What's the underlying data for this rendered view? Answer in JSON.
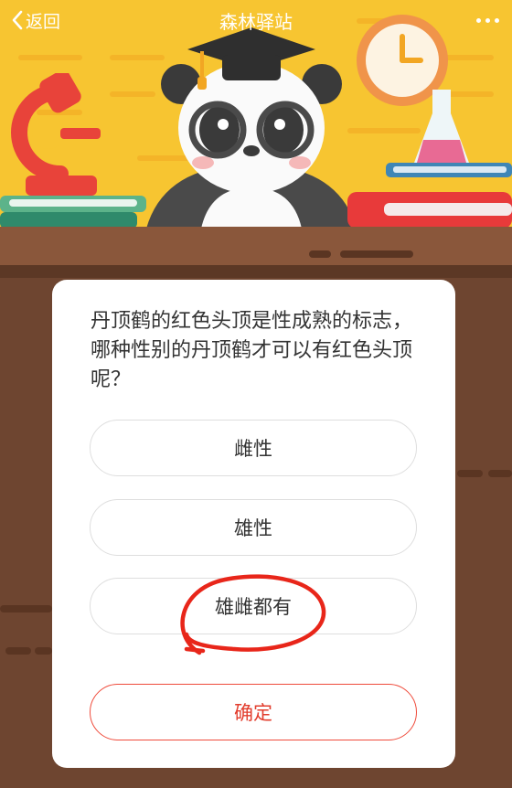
{
  "nav": {
    "back_label": "返回",
    "title": "森林驿站"
  },
  "quiz": {
    "question": "丹顶鹤的红色头顶是性成熟的标志，哪种性别的丹顶鹤才可以有红色头顶呢？",
    "options": [
      {
        "label": "雌性"
      },
      {
        "label": "雄性"
      },
      {
        "label": "雄雌都有",
        "marked": true
      }
    ],
    "confirm_label": "确定"
  },
  "colors": {
    "wall": "#f7c531",
    "desk": "#8a573b",
    "background": "#6e4530",
    "confirm_accent": "#e23d2d",
    "annotation": "#e8261a"
  },
  "icons": [
    "chevron-left-icon",
    "more-dots-icon",
    "microscope-icon",
    "panda-mascot-icon",
    "graduation-cap-icon",
    "clock-icon",
    "flask-icon",
    "books-icon"
  ]
}
